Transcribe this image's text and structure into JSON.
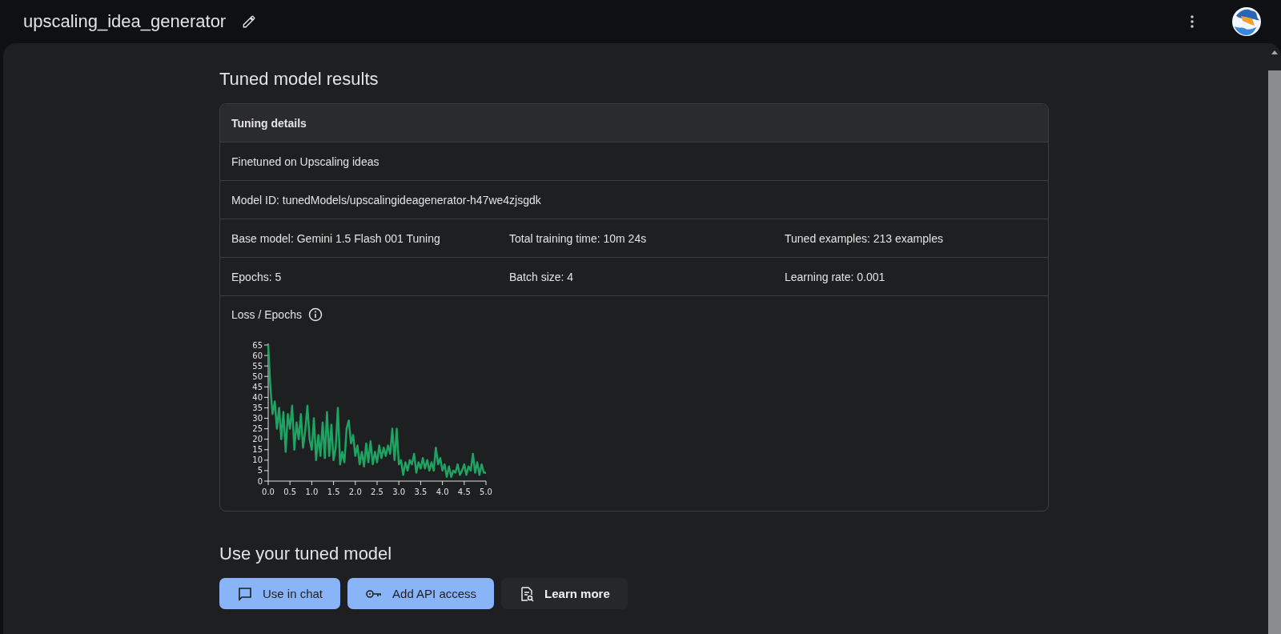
{
  "header": {
    "title": "upscaling_idea_generator"
  },
  "results": {
    "heading": "Tuned model results",
    "card_title": "Tuning details",
    "rows": [
      [
        "Finetuned on Upscaling ideas"
      ],
      [
        "Model ID: tunedModels/upscalingideagenerator-h47we4zjsgdk"
      ],
      [
        "Base model: Gemini 1.5 Flash 001 Tuning",
        "Total training time: 10m 24s",
        "Tuned examples: 213 examples"
      ],
      [
        "Epochs: 5",
        "Batch size: 4",
        "Learning rate: 0.001"
      ]
    ],
    "chart_label": "Loss / Epochs",
    "chart_data": {
      "type": "line",
      "xlim": [
        0,
        5
      ],
      "ylim": [
        0,
        65
      ],
      "xticks": [
        {
          "value": 0,
          "label": "0.0"
        },
        {
          "value": 0.5,
          "label": "0.5"
        },
        {
          "value": 1,
          "label": "1.0"
        },
        {
          "value": 1.5,
          "label": "1.5"
        },
        {
          "value": 2,
          "label": "2.0"
        },
        {
          "value": 2.5,
          "label": "2.5"
        },
        {
          "value": 3,
          "label": "3.0"
        },
        {
          "value": 3.5,
          "label": "3.5"
        },
        {
          "value": 4,
          "label": "4.0"
        },
        {
          "value": 4.5,
          "label": "4.5"
        },
        {
          "value": 5,
          "label": "5.0"
        }
      ],
      "yticks": [
        0,
        5,
        10,
        15,
        20,
        25,
        30,
        35,
        40,
        45,
        50,
        55,
        60,
        65
      ],
      "x": [
        0,
        0.05,
        0.1,
        0.15,
        0.2,
        0.25,
        0.3,
        0.35,
        0.4,
        0.45,
        0.5,
        0.55,
        0.6,
        0.65,
        0.7,
        0.75,
        0.8,
        0.85,
        0.9,
        0.95,
        1,
        1.05,
        1.1,
        1.15,
        1.2,
        1.25,
        1.3,
        1.35,
        1.4,
        1.45,
        1.5,
        1.55,
        1.6,
        1.65,
        1.7,
        1.75,
        1.8,
        1.85,
        1.9,
        1.95,
        2,
        2.05,
        2.1,
        2.15,
        2.2,
        2.25,
        2.3,
        2.35,
        2.4,
        2.45,
        2.5,
        2.55,
        2.6,
        2.65,
        2.7,
        2.75,
        2.8,
        2.85,
        2.9,
        2.95,
        3,
        3.05,
        3.1,
        3.15,
        3.2,
        3.25,
        3.3,
        3.35,
        3.4,
        3.45,
        3.5,
        3.55,
        3.6,
        3.65,
        3.7,
        3.75,
        3.8,
        3.85,
        3.9,
        3.95,
        4,
        4.05,
        4.1,
        4.15,
        4.2,
        4.25,
        4.3,
        4.35,
        4.4,
        4.45,
        4.5,
        4.55,
        4.6,
        4.65,
        4.7,
        4.75,
        4.8,
        4.85,
        4.9,
        4.95,
        5
      ],
      "series": [
        {
          "color": "#1ea362",
          "values": [
            65,
            45,
            32,
            38,
            25,
            35,
            20,
            33,
            14,
            32,
            25,
            36,
            15,
            28,
            20,
            32,
            16,
            24,
            36,
            20,
            15,
            30,
            10,
            22,
            12,
            28,
            11,
            33,
            12,
            27,
            10,
            16,
            35,
            8,
            14,
            9,
            25,
            29,
            18,
            22,
            12,
            17,
            8,
            14,
            7,
            18,
            9,
            19,
            8,
            14,
            9,
            17,
            11,
            16,
            12,
            17,
            13,
            25,
            10,
            25,
            8,
            10,
            3,
            9,
            5,
            10,
            8,
            13,
            4,
            9,
            6,
            11,
            6,
            10,
            5,
            9,
            5,
            16,
            8,
            11,
            5,
            8,
            2,
            7,
            2,
            5,
            4,
            8,
            3,
            5,
            8,
            3,
            7,
            5,
            13,
            4,
            9,
            3,
            8,
            4,
            4
          ]
        }
      ]
    }
  },
  "use": {
    "heading": "Use your tuned model",
    "buttons": [
      {
        "label": "Use in chat",
        "kind": "chat",
        "primary": true
      },
      {
        "label": "Add API access",
        "kind": "key",
        "primary": true
      },
      {
        "label": "Learn more",
        "kind": "doc",
        "primary": false
      }
    ]
  }
}
